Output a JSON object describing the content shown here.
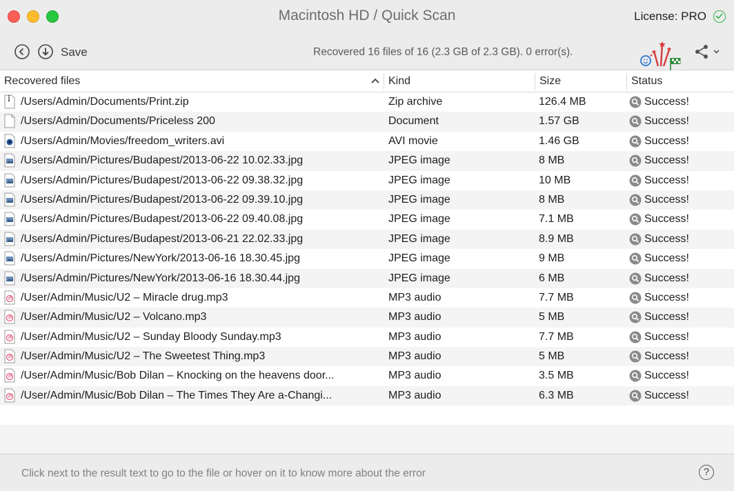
{
  "window": {
    "title": "Macintosh HD / Quick Scan",
    "license": "License: PRO"
  },
  "toolbar": {
    "back_icon": "circle-back-icon",
    "save_icon": "circle-download-icon",
    "save_label": "Save",
    "status": "Recovered 16 files of 16 (2.3 GB of 2.3 GB). 0 error(s).",
    "share_icon": "share-icon"
  },
  "table": {
    "columns": [
      "Recovered files",
      "Kind",
      "Size",
      "Status"
    ],
    "rows": [
      {
        "path": "/Users/Admin/Documents/Print.zip",
        "kind": "Zip archive",
        "size": "126.4 MB",
        "status": "Success!",
        "icon": "zip"
      },
      {
        "path": "/Users/Admin/Documents/Priceless 200",
        "kind": "Document",
        "size": "1.57 GB",
        "status": "Success!",
        "icon": "doc"
      },
      {
        "path": "/Users/Admin/Movies/freedom_writers.avi",
        "kind": "AVI movie",
        "size": "1.46 GB",
        "status": "Success!",
        "icon": "movie"
      },
      {
        "path": "/Users/Admin/Pictures/Budapest/2013-06-22 10.02.33.jpg",
        "kind": "JPEG image",
        "size": "8 MB",
        "status": "Success!",
        "icon": "image"
      },
      {
        "path": "/Users/Admin/Pictures/Budapest/2013-06-22 09.38.32.jpg",
        "kind": "JPEG image",
        "size": "10 MB",
        "status": "Success!",
        "icon": "image"
      },
      {
        "path": "/Users/Admin/Pictures/Budapest/2013-06-22 09.39.10.jpg",
        "kind": "JPEG image",
        "size": "8 MB",
        "status": "Success!",
        "icon": "image"
      },
      {
        "path": "/Users/Admin/Pictures/Budapest/2013-06-22 09.40.08.jpg",
        "kind": "JPEG image",
        "size": "7.1 MB",
        "status": "Success!",
        "icon": "image"
      },
      {
        "path": "/Users/Admin/Pictures/Budapest/2013-06-21 22.02.33.jpg",
        "kind": "JPEG image",
        "size": "8.9 MB",
        "status": "Success!",
        "icon": "image"
      },
      {
        "path": "/Users/Admin/Pictures/NewYork/2013-06-16 18.30.45.jpg",
        "kind": "JPEG image",
        "size": "9 MB",
        "status": "Success!",
        "icon": "image"
      },
      {
        "path": "/Users/Admin/Pictures/NewYork/2013-06-16 18.30.44.jpg",
        "kind": "JPEG image",
        "size": "6 MB",
        "status": "Success!",
        "icon": "image"
      },
      {
        "path": "/User/Admin/Music/U2 – Miracle drug.mp3",
        "kind": "MP3 audio",
        "size": "7.7 MB",
        "status": "Success!",
        "icon": "audio"
      },
      {
        "path": "/User/Admin/Music/U2 – Volcano.mp3",
        "kind": "MP3 audio",
        "size": "5 MB",
        "status": "Success!",
        "icon": "audio"
      },
      {
        "path": "/User/Admin/Music/U2 – Sunday Bloody Sunday.mp3",
        "kind": "MP3 audio",
        "size": "7.7 MB",
        "status": "Success!",
        "icon": "audio"
      },
      {
        "path": "/User/Admin/Music/U2 – The Sweetest Thing.mp3",
        "kind": "MP3 audio",
        "size": "5 MB",
        "status": "Success!",
        "icon": "audio"
      },
      {
        "path": "/User/Admin/Music/Bob Dilan – Knocking on the heavens door...",
        "kind": "MP3 audio",
        "size": "3.5 MB",
        "status": "Success!",
        "icon": "audio"
      },
      {
        "path": "/User/Admin/Music/Bob Dilan – The Times They Are a-Changi...",
        "kind": "MP3 audio",
        "size": "6.3 MB",
        "status": "Success!",
        "icon": "audio"
      }
    ]
  },
  "footer": {
    "hint": "Click next to the result text to go to the file or hover on it to know more about the error",
    "help_label": "?"
  },
  "colors": {
    "close": "#fc5f57",
    "minimize": "#fdbc2e",
    "maximize": "#28c840",
    "license_check": "#34b44a",
    "stripe": "#f4f4f4",
    "chrome": "#ececec"
  }
}
